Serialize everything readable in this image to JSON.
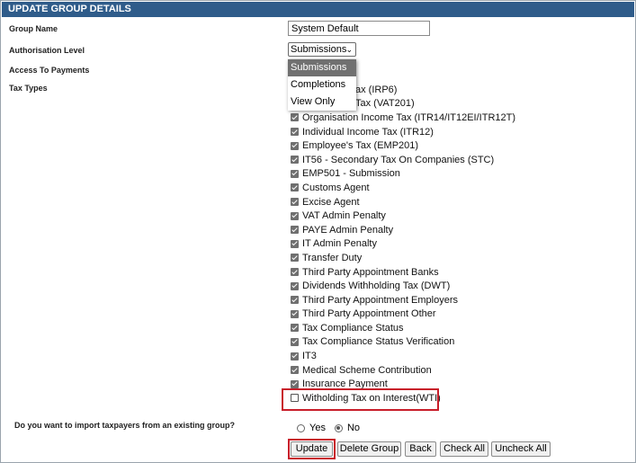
{
  "header": {
    "title": "UPDATE GROUP DETAILS"
  },
  "form": {
    "group_name_label": "Group Name",
    "group_name_value": "System Default",
    "auth_level_label": "Authorisation Level",
    "auth_level_selected": "Submissions",
    "auth_level_options": [
      "Submissions",
      "Completions",
      "View Only"
    ],
    "access_payments_label": "Access To Payments",
    "tax_types_label": "Tax Types"
  },
  "tax_types": [
    {
      "label": "Value Added Tax (IRP6)",
      "visible": "ax (IRP6)",
      "checked": true
    },
    {
      "label": "Value Added Tax (VAT201)",
      "visible": "Tax (VAT201)",
      "checked": true
    },
    {
      "label": "Organisation Income Tax (ITR14/IT12EI/ITR12T)",
      "checked": true
    },
    {
      "label": "Individual Income Tax (ITR12)",
      "checked": true
    },
    {
      "label": "Employee's Tax (EMP201)",
      "checked": true
    },
    {
      "label": "IT56 - Secondary Tax On Companies (STC)",
      "checked": true
    },
    {
      "label": "EMP501 - Submission",
      "checked": true
    },
    {
      "label": "Customs Agent",
      "checked": true
    },
    {
      "label": "Excise Agent",
      "checked": true
    },
    {
      "label": "VAT Admin Penalty",
      "checked": true
    },
    {
      "label": "PAYE Admin Penalty",
      "checked": true
    },
    {
      "label": "IT Admin Penalty",
      "checked": true
    },
    {
      "label": "Transfer Duty",
      "checked": true
    },
    {
      "label": "Third Party Appointment Banks",
      "checked": true
    },
    {
      "label": "Dividends Withholding Tax (DWT)",
      "checked": true
    },
    {
      "label": "Third Party Appointment Employers",
      "checked": true
    },
    {
      "label": "Third Party Appointment Other",
      "checked": true
    },
    {
      "label": "Tax Compliance Status",
      "checked": true
    },
    {
      "label": "Tax Compliance Status Verification",
      "checked": true
    },
    {
      "label": "IT3",
      "checked": true
    },
    {
      "label": "Medical Scheme Contribution",
      "checked": true
    },
    {
      "label": "Insurance Payment",
      "checked": true
    },
    {
      "label": "Witholding Tax on Interest(WTI)",
      "checked": false
    }
  ],
  "import": {
    "question": "Do you want to import taxpayers from an existing group?",
    "yes_label": "Yes",
    "no_label": "No",
    "selected": "No"
  },
  "buttons": {
    "update": "Update",
    "delete_group": "Delete Group",
    "back": "Back",
    "check_all": "Check All",
    "uncheck_all": "Uncheck All"
  },
  "colors": {
    "header_bg": "#2f5c8a",
    "highlight": "#c81e2a"
  }
}
